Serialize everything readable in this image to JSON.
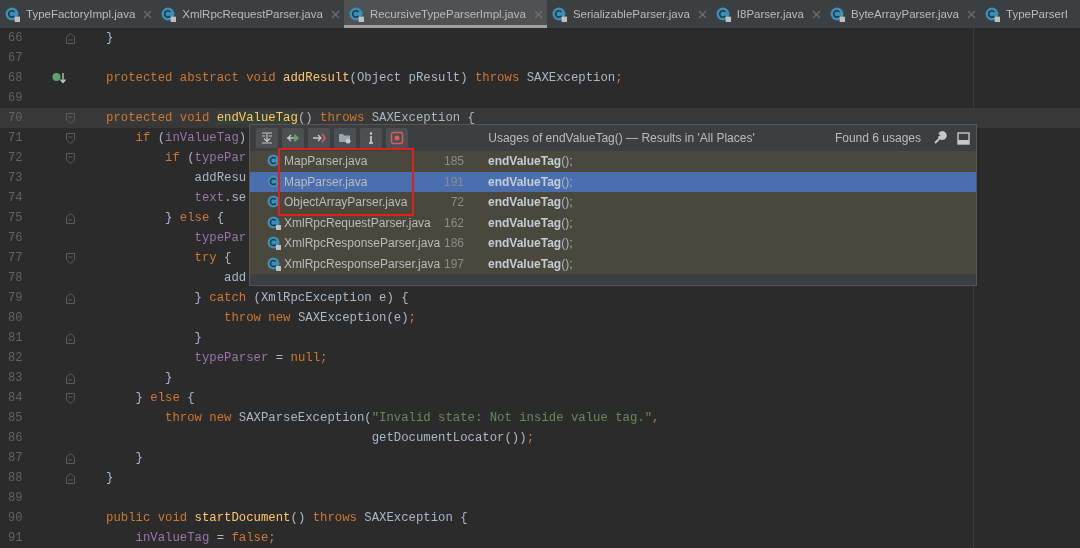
{
  "tabs": [
    {
      "label": "TypeFactoryImpl.java",
      "selected": false,
      "closable": true
    },
    {
      "label": "XmlRpcRequestParser.java",
      "selected": false,
      "closable": true
    },
    {
      "label": "RecursiveTypeParserImpl.java",
      "selected": true,
      "closable": true
    },
    {
      "label": "SerializableParser.java",
      "selected": false,
      "closable": true
    },
    {
      "label": "I8Parser.java",
      "selected": false,
      "closable": true
    },
    {
      "label": "ByteArrayParser.java",
      "selected": false,
      "closable": true
    },
    {
      "label": "TypeParserI",
      "selected": false,
      "closable": false
    }
  ],
  "editor": {
    "lines": [
      {
        "number": "66",
        "gutter": {
          "kind": "fold-end"
        },
        "tokens": [
          {
            "kind": "plain",
            "text": "}"
          }
        ]
      },
      {
        "number": "67"
      },
      {
        "number": "68",
        "gutter": {
          "kind": "implemented"
        },
        "tokens": [
          {
            "kind": "keyword",
            "text": "protected abstract void "
          },
          {
            "kind": "method",
            "text": "addResult"
          },
          {
            "kind": "plain",
            "text": "(Object pResult) "
          },
          {
            "kind": "keyword",
            "text": "throws "
          },
          {
            "kind": "plain",
            "text": "SAXException"
          },
          {
            "kind": "keyword",
            "text": ";"
          }
        ]
      },
      {
        "number": "69"
      },
      {
        "number": "70",
        "current": true,
        "gutter": {
          "kind": "fold-start"
        },
        "tokens": [
          {
            "kind": "keyword",
            "text": "protected void "
          },
          {
            "kind": "usage",
            "text": "endValueTag"
          },
          {
            "kind": "plain",
            "text": "() "
          },
          {
            "kind": "keyword",
            "text": "throws "
          },
          {
            "kind": "plain",
            "text": "SAXException {"
          }
        ]
      },
      {
        "number": "71",
        "gutter": {
          "kind": "fold-start"
        },
        "tokens": [
          {
            "kind": "keyword",
            "text": "    if "
          },
          {
            "kind": "plain",
            "text": "("
          },
          {
            "kind": "field",
            "text": "inValueTag"
          },
          {
            "kind": "plain",
            "text": ")"
          }
        ]
      },
      {
        "number": "72",
        "gutter": {
          "kind": "fold-start"
        },
        "tokens": [
          {
            "kind": "keyword",
            "text": "        if "
          },
          {
            "kind": "plain",
            "text": "("
          },
          {
            "kind": "field",
            "text": "typePar"
          }
        ]
      },
      {
        "number": "73",
        "tokens": [
          {
            "kind": "plain",
            "text": "            addResu"
          }
        ]
      },
      {
        "number": "74",
        "tokens": [
          {
            "kind": "field",
            "text": "            text"
          },
          {
            "kind": "plain",
            "text": ".se"
          }
        ]
      },
      {
        "number": "75",
        "gutter": {
          "kind": "fold-end"
        },
        "tokens": [
          {
            "kind": "plain",
            "text": "        } "
          },
          {
            "kind": "keyword",
            "text": "else "
          },
          {
            "kind": "plain",
            "text": "{"
          }
        ]
      },
      {
        "number": "76",
        "tokens": [
          {
            "kind": "field",
            "text": "            typePar"
          }
        ]
      },
      {
        "number": "77",
        "gutter": {
          "kind": "fold-start"
        },
        "tokens": [
          {
            "kind": "keyword",
            "text": "            try "
          },
          {
            "kind": "plain",
            "text": "{"
          }
        ]
      },
      {
        "number": "78",
        "tokens": [
          {
            "kind": "plain",
            "text": "                add"
          }
        ]
      },
      {
        "number": "79",
        "gutter": {
          "kind": "fold-end"
        },
        "tokens": [
          {
            "kind": "plain",
            "text": "            } "
          },
          {
            "kind": "keyword",
            "text": "catch "
          },
          {
            "kind": "plain",
            "text": "(XmlRpcException e) {"
          }
        ]
      },
      {
        "number": "80",
        "tokens": [
          {
            "kind": "keyword",
            "text": "                throw new "
          },
          {
            "kind": "plain",
            "text": "SAXException(e)"
          },
          {
            "kind": "keyword",
            "text": ";"
          }
        ]
      },
      {
        "number": "81",
        "gutter": {
          "kind": "fold-end"
        },
        "tokens": [
          {
            "kind": "plain",
            "text": "            }"
          }
        ]
      },
      {
        "number": "82",
        "tokens": [
          {
            "kind": "field",
            "text": "            typeParser"
          },
          {
            "kind": "plain",
            "text": " = "
          },
          {
            "kind": "keyword",
            "text": "null;"
          }
        ]
      },
      {
        "number": "83",
        "gutter": {
          "kind": "fold-end"
        },
        "tokens": [
          {
            "kind": "plain",
            "text": "        }"
          }
        ]
      },
      {
        "number": "84",
        "gutter": {
          "kind": "fold-start"
        },
        "tokens": [
          {
            "kind": "plain",
            "text": "    } "
          },
          {
            "kind": "keyword",
            "text": "else "
          },
          {
            "kind": "plain",
            "text": "{"
          }
        ]
      },
      {
        "number": "85",
        "tokens": [
          {
            "kind": "keyword",
            "text": "        throw new "
          },
          {
            "kind": "plain",
            "text": "SAXParseException("
          },
          {
            "kind": "string",
            "text": "\"Invalid state: Not inside value tag.\""
          },
          {
            "kind": "keyword",
            "text": ","
          }
        ]
      },
      {
        "number": "86",
        "tokens": [
          {
            "kind": "plain",
            "text": "                                    getDocumentLocator())"
          },
          {
            "kind": "keyword",
            "text": ";"
          }
        ]
      },
      {
        "number": "87",
        "gutter": {
          "kind": "fold-end"
        },
        "tokens": [
          {
            "kind": "plain",
            "text": "    }"
          }
        ]
      },
      {
        "number": "88",
        "gutter": {
          "kind": "fold-end"
        },
        "tokens": [
          {
            "kind": "plain",
            "text": "}"
          }
        ]
      },
      {
        "number": "89"
      },
      {
        "number": "90",
        "tokens": [
          {
            "kind": "keyword",
            "text": "public void "
          },
          {
            "kind": "method",
            "text": "startDocument"
          },
          {
            "kind": "plain",
            "text": "() "
          },
          {
            "kind": "keyword",
            "text": "throws "
          },
          {
            "kind": "plain",
            "text": "SAXException {"
          }
        ]
      },
      {
        "number": "91",
        "tokens": [
          {
            "kind": "field",
            "text": "    inValueTag"
          },
          {
            "kind": "plain",
            "text": " = "
          },
          {
            "kind": "keyword",
            "text": "false;"
          }
        ]
      }
    ]
  },
  "usages_popup": {
    "title": "Usages of endValueTag() — Results in 'All Places'",
    "count": "Found 6 usages",
    "toolbar": [
      {
        "kind": "expand"
      },
      {
        "kind": "next"
      },
      {
        "kind": "previous"
      },
      {
        "kind": "group"
      },
      {
        "kind": "info"
      },
      {
        "kind": "settings"
      }
    ],
    "rows": [
      {
        "file": "MapParser.java",
        "line": "185",
        "code": "**endValueTag**();",
        "selected": false,
        "locked": false,
        "marked": true
      },
      {
        "file": "MapParser.java",
        "line": "191",
        "code": "**endValueTag**();",
        "selected": true,
        "locked": false,
        "marked": true
      },
      {
        "file": "ObjectArrayParser.java",
        "line": "72",
        "code": "**endValueTag**();",
        "selected": false,
        "locked": false,
        "marked": true
      },
      {
        "file": "XmlRpcRequestParser.java",
        "line": "162",
        "code": "**endValueTag**();",
        "selected": false,
        "locked": true,
        "marked": false
      },
      {
        "file": "XmlRpcResponseParser.java",
        "line": "186",
        "code": "**endValueTag**();",
        "selected": false,
        "locked": true,
        "marked": false
      },
      {
        "file": "XmlRpcResponseParser.java",
        "line": "197",
        "code": "**endValueTag**();",
        "selected": false,
        "locked": true,
        "marked": false
      }
    ]
  }
}
